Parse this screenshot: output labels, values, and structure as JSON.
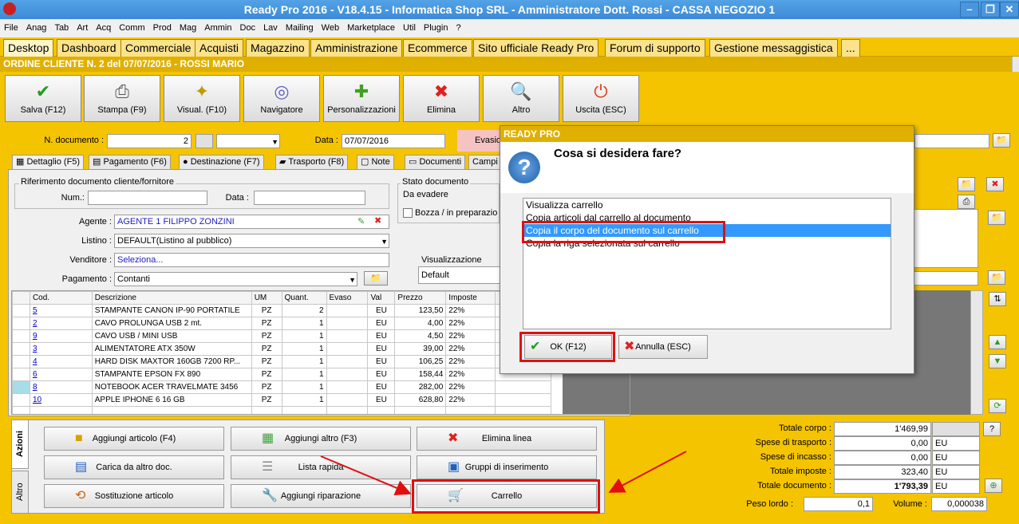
{
  "window": {
    "title": "Ready Pro 2016 - V18.4.15 - Informatica Shop SRL - Amministratore Dott. Rossi - CASSA NEGOZIO 1"
  },
  "menu": [
    "File",
    "Anag",
    "Tab",
    "Art",
    "Acq",
    "Comm",
    "Prod",
    "Mag",
    "Ammin",
    "Doc",
    "Lav",
    "Mailing",
    "Web",
    "Marketplace",
    "Util",
    "Plugin",
    "?"
  ],
  "tabs": [
    "Desktop",
    "Dashboard",
    "Commerciale",
    "Acquisti",
    "Magazzino",
    "Amministrazione",
    "Ecommerce",
    "Sito ufficiale Ready Pro",
    "Forum di supporto",
    "Gestione messaggistica",
    "..."
  ],
  "order_title": "ORDINE CLIENTE N. 2 del 07/07/2016 - ROSSI MARIO",
  "toolbar": [
    {
      "label": "Salva (F12)",
      "icon": "check-icon"
    },
    {
      "label": "Stampa (F9)",
      "icon": "printer-icon"
    },
    {
      "label": "Visual. (F10)",
      "icon": "magic-wand-icon"
    },
    {
      "label": "Navigatore",
      "icon": "compass-icon"
    },
    {
      "label": "Personalizzazioni",
      "icon": "puzzle-icon"
    },
    {
      "label": "Elimina",
      "icon": "delete-x-icon"
    },
    {
      "label": "Altro",
      "icon": "book-search-icon"
    },
    {
      "label": "Uscita (ESC)",
      "icon": "power-icon"
    }
  ],
  "header": {
    "n_doc_label": "N. documento :",
    "n_doc_value": "2",
    "data_label": "Data :",
    "data_value": "07/07/2016",
    "evasio_label": "Evasio"
  },
  "subtabs": [
    "Dettaglio (F5)",
    "Pagamento (F6)",
    "Destinazione (F7)",
    "Trasporto (F8)",
    "Note",
    "Documenti",
    "Campi"
  ],
  "riferimento": {
    "title": "Riferimento documento cliente/fornitore",
    "num_label": "Num.:",
    "data_label": "Data :"
  },
  "stato": {
    "title": "Stato documento",
    "value": "Da evadere",
    "bozza": "Bozza / in preparazio"
  },
  "form": {
    "agente_label": "Agente :",
    "agente_value": "AGENTE 1 FILIPPO ZONZINI",
    "listino_label": "Listino :",
    "listino_value": "DEFAULT(Listino al pubblico)",
    "venditore_label": "Venditore :",
    "venditore_value": "Seleziona...",
    "pagamento_label": "Pagamento :",
    "pagamento_value": "Contanti",
    "visual_label": "Visualizzazione",
    "visual_value": "Default"
  },
  "table": {
    "headers": [
      "Cod.",
      "Descrizione",
      "UM",
      "Quant.",
      "Evaso",
      "Val",
      "Prezzo",
      "Imposte"
    ],
    "rows": [
      [
        "5",
        "STAMPANTE CANON IP-90 PORTATILE",
        "PZ",
        "2",
        "",
        "EU",
        "123,50",
        "22%"
      ],
      [
        "2",
        "CAVO PROLUNGA USB 2 mt.",
        "PZ",
        "1",
        "",
        "EU",
        "4,00",
        "22%"
      ],
      [
        "9",
        "CAVO USB / MINI USB",
        "PZ",
        "1",
        "",
        "EU",
        "4,50",
        "22%"
      ],
      [
        "3",
        "ALIMENTATORE ATX 350W",
        "PZ",
        "1",
        "",
        "EU",
        "39,00",
        "22%"
      ],
      [
        "4",
        "HARD DISK MAXTOR 160GB 7200 RP...",
        "PZ",
        "1",
        "",
        "EU",
        "106,25",
        "22%"
      ],
      [
        "6",
        "STAMPANTE EPSON FX 890",
        "PZ",
        "1",
        "",
        "EU",
        "158,44",
        "22%"
      ],
      [
        "8",
        "NOTEBOOK ACER TRAVELMATE 3456",
        "PZ",
        "1",
        "",
        "EU",
        "282,00",
        "22%"
      ],
      [
        "10",
        "APPLE IPHONE 6 16 GB",
        "PZ",
        "1",
        "",
        "EU",
        "628,80",
        "22%"
      ]
    ]
  },
  "side_tabs": [
    "Azioni",
    "Altro"
  ],
  "actions": [
    {
      "label": "Aggiungi articolo (F4)",
      "icon": "add-article-icon"
    },
    {
      "label": "Aggiungi altro (F3)",
      "icon": "add-other-icon"
    },
    {
      "label": "Elimina linea",
      "icon": "delete-line-icon"
    },
    {
      "label": "Carica da altro doc.",
      "icon": "load-doc-icon"
    },
    {
      "label": "Lista rapida",
      "icon": "quick-list-icon"
    },
    {
      "label": "Gruppi di inserimento",
      "icon": "groups-icon"
    },
    {
      "label": "Sostituzione articolo",
      "icon": "replace-icon"
    },
    {
      "label": "Aggiungi riparazione",
      "icon": "wrench-icon"
    },
    {
      "label": "Carrello",
      "icon": "cart-icon"
    }
  ],
  "totals": [
    {
      "label": "Totale corpo :",
      "value": "1'469,99",
      "cur": ""
    },
    {
      "label": "Spese di trasporto :",
      "value": "0,00",
      "cur": "EU"
    },
    {
      "label": "Spese di incasso :",
      "value": "0,00",
      "cur": "EU"
    },
    {
      "label": "Totale imposte :",
      "value": "323,40",
      "cur": "EU"
    },
    {
      "label": "Totale documento :",
      "value": "1'793,39",
      "cur": "EU"
    }
  ],
  "peso": {
    "label": "Peso lordo :",
    "value": "0,1"
  },
  "volume": {
    "label": "Volume :",
    "value": "0,000038"
  },
  "dialog": {
    "title": "READY PRO",
    "question": "Cosa si desidera fare?",
    "options": [
      "Visualizza carrello",
      "Copia articoli dal carrello al documento",
      "Copia il corpo del documento sul carrello",
      "Copia la riga selezionata sul carrello"
    ],
    "selected_index": 2,
    "ok_label": "OK (F12)",
    "cancel_label": "Annulla (ESC)"
  },
  "colors": {
    "accent_yellow": "#f5c400",
    "highlight_red": "#e01010",
    "selection_blue": "#3399ff"
  }
}
